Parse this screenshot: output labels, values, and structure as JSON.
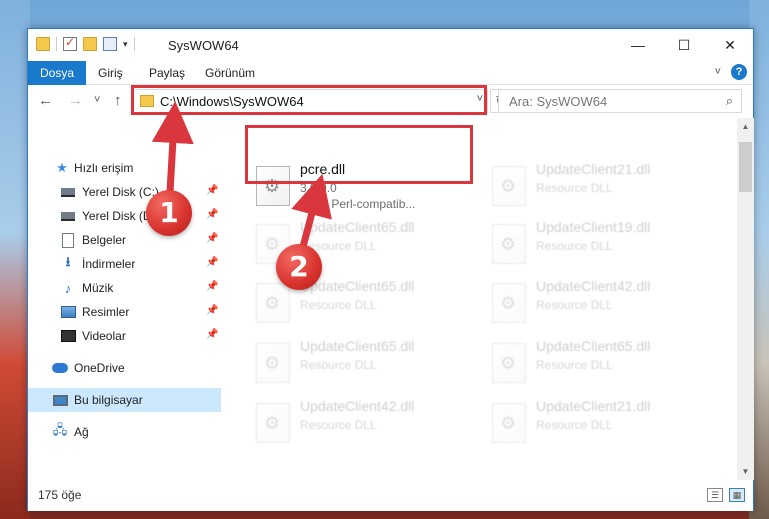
{
  "window": {
    "title": "SysWOW64",
    "controls": {
      "minimize": "—",
      "maximize": "☐",
      "close": "✕"
    }
  },
  "ribbon": {
    "tabs": [
      {
        "label": "Dosya",
        "active": true
      },
      {
        "label": "Giriş"
      },
      {
        "label": "Paylaş"
      },
      {
        "label": "Görünüm"
      }
    ],
    "expand_icon": "chevron-down-icon",
    "help_glyph": "?"
  },
  "nav_buttons": {
    "back": "←",
    "forward": "→",
    "recent": "˅",
    "up": "↑"
  },
  "address": {
    "path": "C:\\Windows\\SysWOW64",
    "dropdown_glyph": "˅",
    "refresh_glyph": "↻"
  },
  "search": {
    "placeholder": "Ara: SysWOW64",
    "icon_glyph": "⌕"
  },
  "sidebar": {
    "items": [
      {
        "label": "Hızlı erişim",
        "icon": "star-icon",
        "pinned": false
      },
      {
        "label": "Yerel Disk (C:)",
        "icon": "drive-icon",
        "pinned": true
      },
      {
        "label": "Yerel Disk (D:)",
        "icon": "drive-icon",
        "pinned": true
      },
      {
        "label": "Belgeler",
        "icon": "documents-icon",
        "pinned": true
      },
      {
        "label": "İndirmeler",
        "icon": "download-icon",
        "pinned": true
      },
      {
        "label": "Müzik",
        "icon": "music-icon",
        "pinned": true
      },
      {
        "label": "Resimler",
        "icon": "pictures-icon",
        "pinned": true
      },
      {
        "label": "Videolar",
        "icon": "videos-icon",
        "pinned": true
      },
      {
        "label": "OneDrive",
        "icon": "cloud-icon",
        "pinned": false
      },
      {
        "label": "Bu bilgisayar",
        "icon": "computer-icon",
        "selected": true
      },
      {
        "label": "Ağ",
        "icon": "network-icon",
        "pinned": false
      }
    ],
    "pin_glyph": "📌"
  },
  "files": [
    {
      "name": "pcre.dll",
      "line1": "3.9.0.0",
      "line2": "Pcre: Perl-compatib...",
      "highlighted": true
    },
    {
      "name": "UpdateClient21.dll",
      "line1": "Resource DLL",
      "line2": "",
      "faded": true
    },
    {
      "name": "UpdateClient65.dll",
      "line1": "Resource DLL",
      "line2": "",
      "faded": true
    },
    {
      "name": "UpdateClient19.dll",
      "line1": "Resource DLL",
      "line2": "",
      "faded": true
    },
    {
      "name": "UpdateClient65.dll",
      "line1": "Resource DLL",
      "line2": "",
      "faded": true
    },
    {
      "name": "UpdateClient42.dll",
      "line1": "Resource DLL",
      "line2": "",
      "faded": true
    },
    {
      "name": "UpdateClient65.dll",
      "line1": "Resource DLL",
      "line2": "",
      "faded": true
    },
    {
      "name": "UpdateClient65.dll",
      "line1": "Resource DLL",
      "line2": "",
      "faded": true
    },
    {
      "name": "UpdateClient42.dll",
      "line1": "Resource DLL",
      "line2": "",
      "faded": true
    },
    {
      "name": "UpdateClient21.dll",
      "line1": "Resource DLL",
      "line2": "",
      "faded": true
    }
  ],
  "status": {
    "count": "175 öğe"
  },
  "annotations": {
    "badge1": "1",
    "badge2": "2",
    "color": "#d9363e"
  }
}
